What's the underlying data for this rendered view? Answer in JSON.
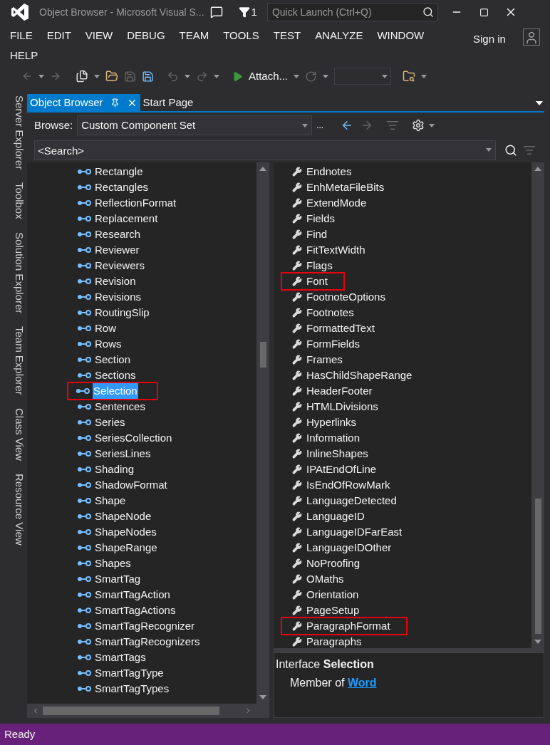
{
  "window": {
    "title": "Object Browser - Microsoft Visual S...",
    "notification_count": "1",
    "quick_launch": {
      "placeholder": "Quick Launch (Ctrl+Q)"
    }
  },
  "menu": [
    "FILE",
    "EDIT",
    "VIEW",
    "DEBUG",
    "TEAM",
    "TOOLS",
    "TEST",
    "ANALYZE",
    "WINDOW",
    "HELP"
  ],
  "sign_in": "Sign in",
  "toolbar": {
    "attach": "Attach..."
  },
  "side_tabs": [
    "Server Explorer",
    "Toolbox",
    "Solution Explorer",
    "Team Explorer",
    "Class View",
    "Resource View"
  ],
  "doc_tabs": [
    {
      "label": "Object Browser",
      "selected": true
    },
    {
      "label": "Start Page",
      "selected": false
    }
  ],
  "browse": {
    "label": "Browse:",
    "value": "Custom Component Set",
    "more": "..."
  },
  "search": {
    "placeholder": "<Search>"
  },
  "objects": [
    {
      "name": "Rectangle",
      "selected": false,
      "outlined": false
    },
    {
      "name": "Rectangles",
      "selected": false,
      "outlined": false
    },
    {
      "name": "ReflectionFormat",
      "selected": false,
      "outlined": false
    },
    {
      "name": "Replacement",
      "selected": false,
      "outlined": false
    },
    {
      "name": "Research",
      "selected": false,
      "outlined": false
    },
    {
      "name": "Reviewer",
      "selected": false,
      "outlined": false
    },
    {
      "name": "Reviewers",
      "selected": false,
      "outlined": false
    },
    {
      "name": "Revision",
      "selected": false,
      "outlined": false
    },
    {
      "name": "Revisions",
      "selected": false,
      "outlined": false
    },
    {
      "name": "RoutingSlip",
      "selected": false,
      "outlined": false
    },
    {
      "name": "Row",
      "selected": false,
      "outlined": false
    },
    {
      "name": "Rows",
      "selected": false,
      "outlined": false
    },
    {
      "name": "Section",
      "selected": false,
      "outlined": false
    },
    {
      "name": "Sections",
      "selected": false,
      "outlined": false
    },
    {
      "name": "Selection",
      "selected": true,
      "outlined": true
    },
    {
      "name": "Sentences",
      "selected": false,
      "outlined": false
    },
    {
      "name": "Series",
      "selected": false,
      "outlined": false
    },
    {
      "name": "SeriesCollection",
      "selected": false,
      "outlined": false
    },
    {
      "name": "SeriesLines",
      "selected": false,
      "outlined": false
    },
    {
      "name": "Shading",
      "selected": false,
      "outlined": false
    },
    {
      "name": "ShadowFormat",
      "selected": false,
      "outlined": false
    },
    {
      "name": "Shape",
      "selected": false,
      "outlined": false
    },
    {
      "name": "ShapeNode",
      "selected": false,
      "outlined": false
    },
    {
      "name": "ShapeNodes",
      "selected": false,
      "outlined": false
    },
    {
      "name": "ShapeRange",
      "selected": false,
      "outlined": false
    },
    {
      "name": "Shapes",
      "selected": false,
      "outlined": false
    },
    {
      "name": "SmartTag",
      "selected": false,
      "outlined": false
    },
    {
      "name": "SmartTagAction",
      "selected": false,
      "outlined": false
    },
    {
      "name": "SmartTagActions",
      "selected": false,
      "outlined": false
    },
    {
      "name": "SmartTagRecognizer",
      "selected": false,
      "outlined": false
    },
    {
      "name": "SmartTagRecognizers",
      "selected": false,
      "outlined": false
    },
    {
      "name": "SmartTags",
      "selected": false,
      "outlined": false
    },
    {
      "name": "SmartTagType",
      "selected": false,
      "outlined": false
    },
    {
      "name": "SmartTagTypes",
      "selected": false,
      "outlined": false
    }
  ],
  "members": [
    {
      "name": "Endnotes",
      "outlined": false
    },
    {
      "name": "EnhMetaFileBits",
      "outlined": false
    },
    {
      "name": "ExtendMode",
      "outlined": false
    },
    {
      "name": "Fields",
      "outlined": false
    },
    {
      "name": "Find",
      "outlined": false
    },
    {
      "name": "FitTextWidth",
      "outlined": false
    },
    {
      "name": "Flags",
      "outlined": false
    },
    {
      "name": "Font",
      "outlined": true
    },
    {
      "name": "FootnoteOptions",
      "outlined": false
    },
    {
      "name": "Footnotes",
      "outlined": false
    },
    {
      "name": "FormattedText",
      "outlined": false
    },
    {
      "name": "FormFields",
      "outlined": false
    },
    {
      "name": "Frames",
      "outlined": false
    },
    {
      "name": "HasChildShapeRange",
      "outlined": false
    },
    {
      "name": "HeaderFooter",
      "outlined": false
    },
    {
      "name": "HTMLDivisions",
      "outlined": false
    },
    {
      "name": "Hyperlinks",
      "outlined": false
    },
    {
      "name": "Information",
      "outlined": false
    },
    {
      "name": "InlineShapes",
      "outlined": false
    },
    {
      "name": "IPAtEndOfLine",
      "outlined": false
    },
    {
      "name": "IsEndOfRowMark",
      "outlined": false
    },
    {
      "name": "LanguageDetected",
      "outlined": false
    },
    {
      "name": "LanguageID",
      "outlined": false
    },
    {
      "name": "LanguageIDFarEast",
      "outlined": false
    },
    {
      "name": "LanguageIDOther",
      "outlined": false
    },
    {
      "name": "NoProofing",
      "outlined": false
    },
    {
      "name": "OMaths",
      "outlined": false
    },
    {
      "name": "Orientation",
      "outlined": false
    },
    {
      "name": "PageSetup",
      "outlined": false
    },
    {
      "name": "ParagraphFormat",
      "outlined": true
    },
    {
      "name": "Paragraphs",
      "outlined": false
    }
  ],
  "description": {
    "heading": "Interface **Selection**",
    "member_of": "Member of",
    "link": "Word"
  },
  "status_bar": {
    "text": "Ready"
  }
}
